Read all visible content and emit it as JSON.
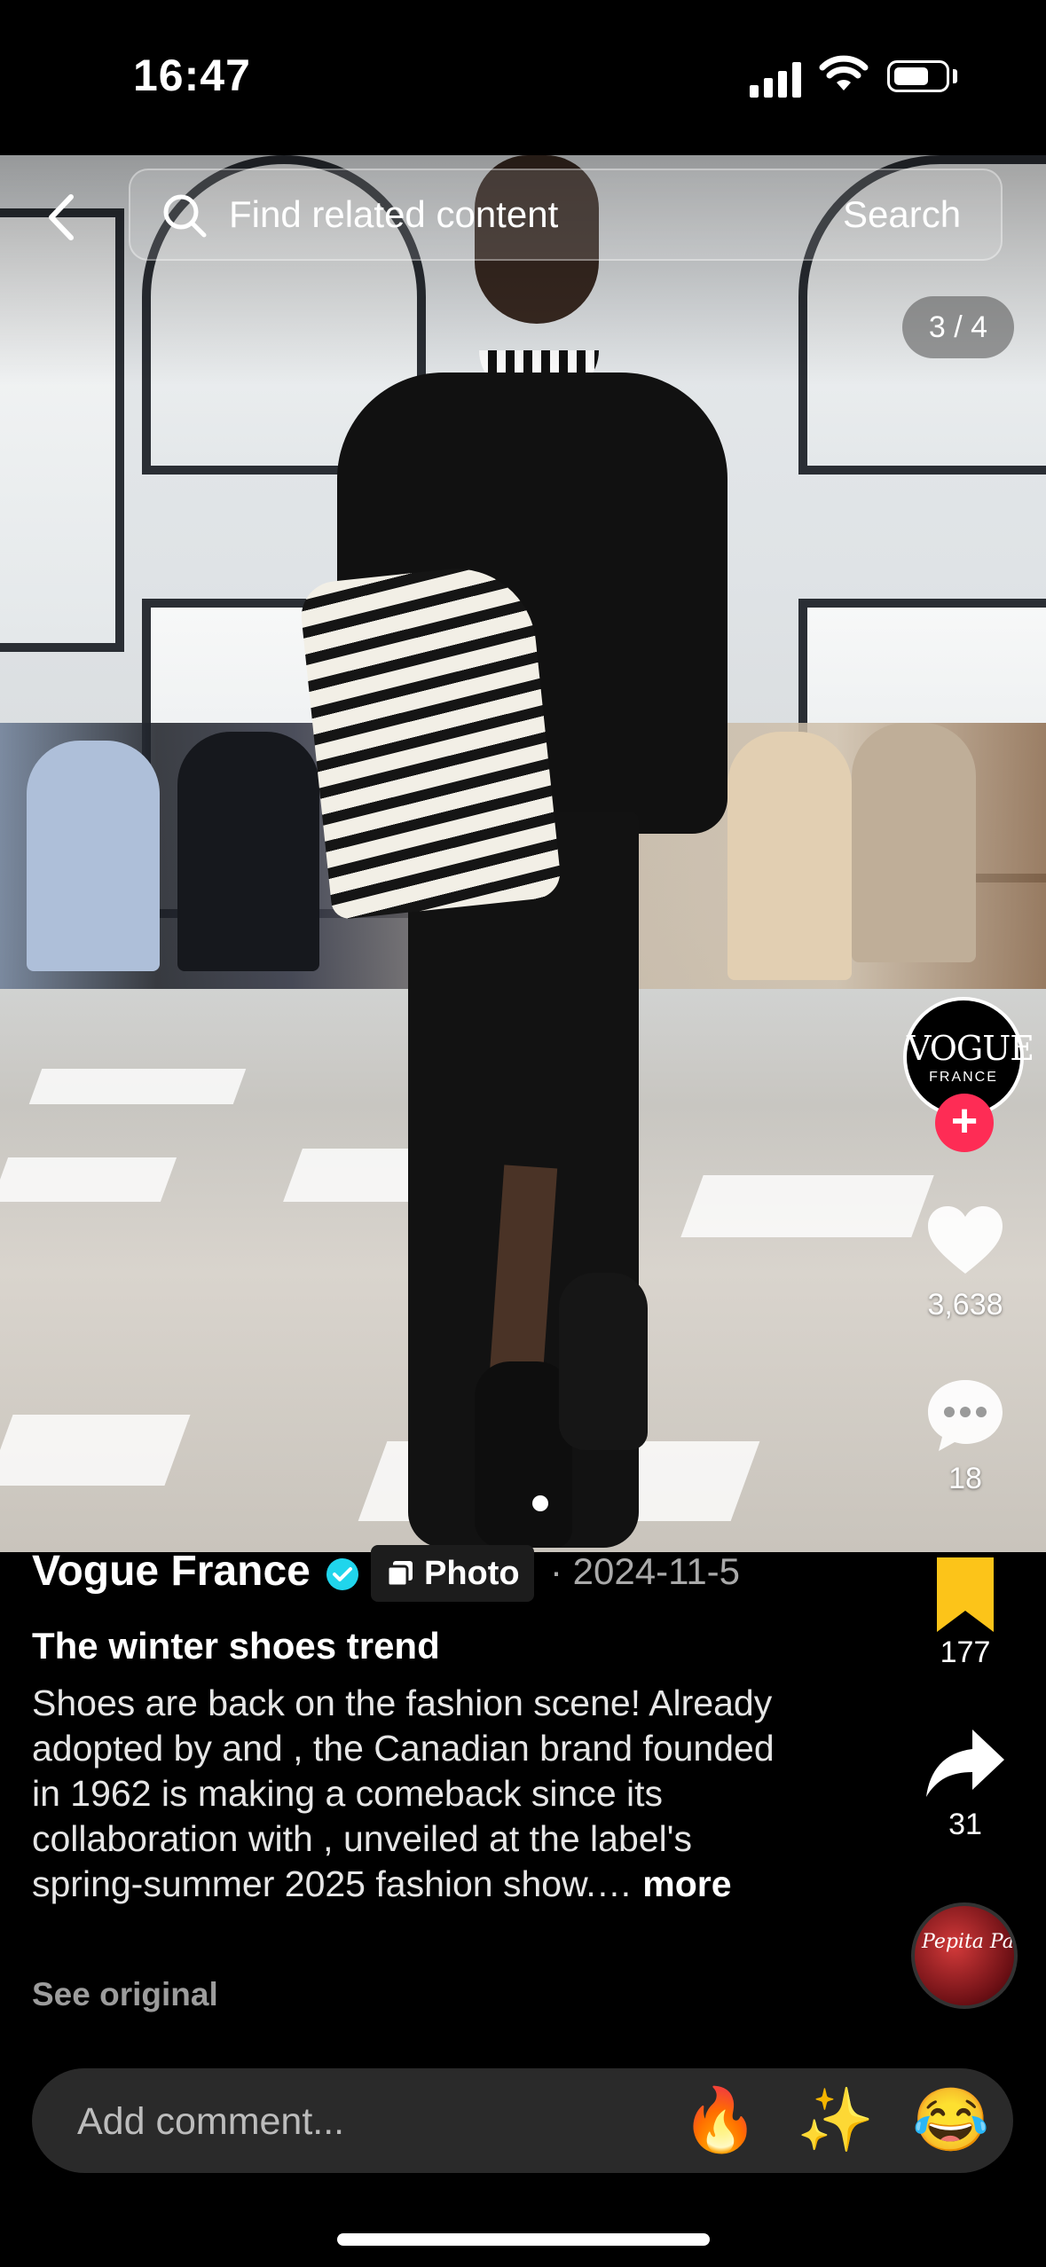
{
  "status_bar": {
    "time": "16:47"
  },
  "search": {
    "placeholder": "Find related content",
    "button_label": "Search"
  },
  "viewer": {
    "page_counter": "3 / 4",
    "current_page": 3,
    "total_pages": 4
  },
  "author": {
    "name": "Vogue France",
    "avatar_logo": "VOGUE",
    "avatar_subtitle": "FRANCE",
    "verified": true
  },
  "post": {
    "type_label": "Photo",
    "date": "· 2024-11-5",
    "title": "The winter shoes trend",
    "description": "Shoes are back on the fashion scene! Already adopted by and , the Canadian brand founded in 1962 is making a comeback since its collaboration with , unveiled at the label's spring-summer 2025 fashion show.…",
    "more_label": "more",
    "see_original": "See original"
  },
  "actions": {
    "likes": "3,638",
    "comments": "18",
    "saves": "177",
    "shares": "31"
  },
  "music": {
    "avatar_text": "Pepita Pa"
  },
  "comment_bar": {
    "placeholder": "Add comment...",
    "emojis": [
      "🔥",
      "✨",
      "😂"
    ]
  },
  "colors": {
    "accent_red": "#fe2c55",
    "save_yellow": "#fcc419",
    "verified_blue": "#20d5ec"
  }
}
